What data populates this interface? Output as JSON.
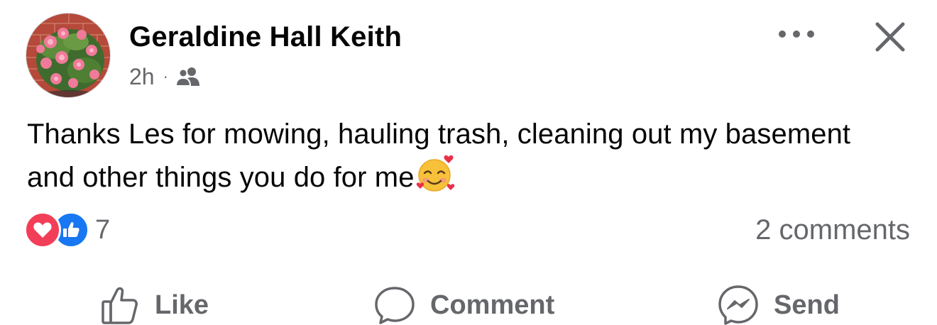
{
  "post": {
    "author": "Geraldine Hall Keith",
    "time": "2h",
    "separator": "·",
    "audience_icon": "friends-icon",
    "text": "Thanks Les for mowing, hauling trash, cleaning out my basement and other things you do for me",
    "emoji": "smiling-face-with-hearts"
  },
  "reactions": {
    "types": [
      "love",
      "like"
    ],
    "count": "7"
  },
  "comments": {
    "label": "2 comments"
  },
  "actions": {
    "like": "Like",
    "comment": "Comment",
    "send": "Send"
  },
  "colors": {
    "text": "#050505",
    "secondary": "#65676b",
    "like_blue": "#1877f2",
    "love_red": "#f33e58"
  }
}
